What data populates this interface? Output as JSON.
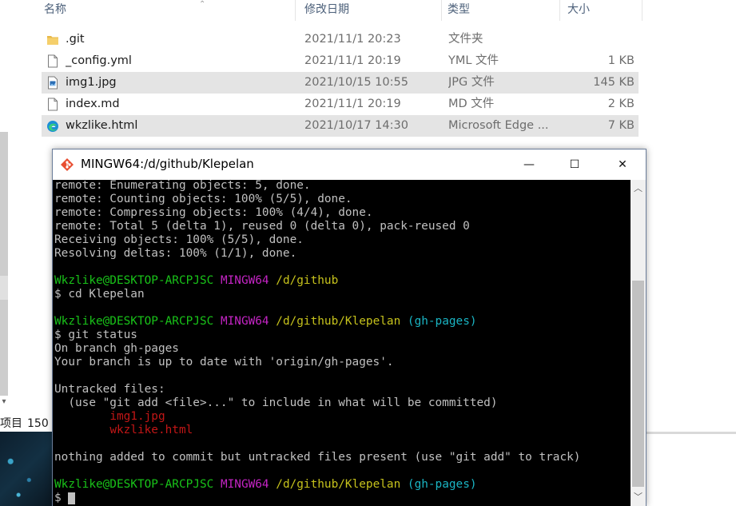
{
  "explorer": {
    "columns": {
      "name": "名称",
      "date": "修改日期",
      "type": "类型",
      "size": "大小"
    },
    "files": [
      {
        "icon": "folder-icon",
        "name": ".git",
        "date": "2021/11/1 20:23",
        "type": "文件夹",
        "size": "",
        "selected": false
      },
      {
        "icon": "file-icon",
        "name": "_config.yml",
        "date": "2021/11/1 20:19",
        "type": "YML 文件",
        "size": "1 KB",
        "selected": false
      },
      {
        "icon": "image-file-icon",
        "name": "img1.jpg",
        "date": "2021/10/15 10:55",
        "type": "JPG 文件",
        "size": "145 KB",
        "selected": true
      },
      {
        "icon": "file-icon",
        "name": "index.md",
        "date": "2021/11/1 20:19",
        "type": "MD 文件",
        "size": "2 KB",
        "selected": false
      },
      {
        "icon": "edge-icon",
        "name": "wkzlike.html",
        "date": "2021/10/17 14:30",
        "type": "Microsoft Edge ...",
        "size": "7 KB",
        "selected": true
      }
    ],
    "status": {
      "items_label": "项目",
      "count": "150"
    }
  },
  "terminal": {
    "title": "MINGW64:/d/github/Klepelan",
    "controls": {
      "minimize": "—",
      "maximize": "☐",
      "close": "✕"
    },
    "lines": [
      [
        {
          "t": "remote: Enumerating objects: 5, done.",
          "c": ""
        }
      ],
      [
        {
          "t": "remote: Counting objects: 100% (5/5), done.",
          "c": ""
        }
      ],
      [
        {
          "t": "remote: Compressing objects: 100% (4/4), done.",
          "c": ""
        }
      ],
      [
        {
          "t": "remote: Total 5 (delta 1), reused 0 (delta 0), pack-reused 0",
          "c": ""
        }
      ],
      [
        {
          "t": "Receiving objects: 100% (5/5), done.",
          "c": ""
        }
      ],
      [
        {
          "t": "Resolving deltas: 100% (1/1), done.",
          "c": ""
        }
      ],
      [
        {
          "t": "",
          "c": ""
        }
      ],
      [
        {
          "t": "Wkzlike@DESKTOP-ARCPJSC",
          "c": "g"
        },
        {
          "t": " ",
          "c": ""
        },
        {
          "t": "MINGW64",
          "c": "m"
        },
        {
          "t": " ",
          "c": ""
        },
        {
          "t": "/d/github",
          "c": "y"
        }
      ],
      [
        {
          "t": "$ cd Klepelan",
          "c": ""
        }
      ],
      [
        {
          "t": "",
          "c": ""
        }
      ],
      [
        {
          "t": "Wkzlike@DESKTOP-ARCPJSC",
          "c": "g"
        },
        {
          "t": " ",
          "c": ""
        },
        {
          "t": "MINGW64",
          "c": "m"
        },
        {
          "t": " ",
          "c": ""
        },
        {
          "t": "/d/github/Klepelan",
          "c": "y"
        },
        {
          "t": " ",
          "c": ""
        },
        {
          "t": "(gh-pages)",
          "c": "cy"
        }
      ],
      [
        {
          "t": "$ git status",
          "c": ""
        }
      ],
      [
        {
          "t": "On branch gh-pages",
          "c": ""
        }
      ],
      [
        {
          "t": "Your branch is up to date with 'origin/gh-pages'.",
          "c": ""
        }
      ],
      [
        {
          "t": "",
          "c": ""
        }
      ],
      [
        {
          "t": "Untracked files:",
          "c": ""
        }
      ],
      [
        {
          "t": "  (use \"git add <file>...\" to include in what will be committed)",
          "c": ""
        }
      ],
      [
        {
          "t": "        ",
          "c": ""
        },
        {
          "t": "img1.jpg",
          "c": "r"
        }
      ],
      [
        {
          "t": "        ",
          "c": ""
        },
        {
          "t": "wkzlike.html",
          "c": "r"
        }
      ],
      [
        {
          "t": "",
          "c": ""
        }
      ],
      [
        {
          "t": "nothing added to commit but untracked files present (use \"git add\" to track)",
          "c": ""
        }
      ],
      [
        {
          "t": "",
          "c": ""
        }
      ],
      [
        {
          "t": "Wkzlike@DESKTOP-ARCPJSC",
          "c": "g"
        },
        {
          "t": " ",
          "c": ""
        },
        {
          "t": "MINGW64",
          "c": "m"
        },
        {
          "t": " ",
          "c": ""
        },
        {
          "t": "/d/github/Klepelan",
          "c": "y"
        },
        {
          "t": " ",
          "c": ""
        },
        {
          "t": "(gh-pages)",
          "c": "cy"
        }
      ],
      [
        {
          "t": "$ ",
          "c": ""
        }
      ]
    ]
  }
}
